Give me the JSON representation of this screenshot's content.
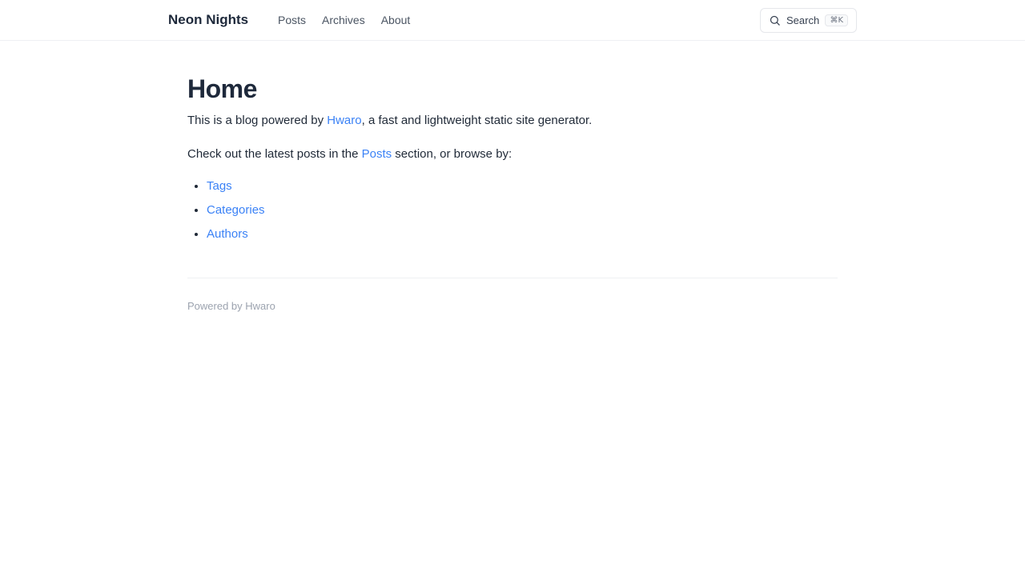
{
  "header": {
    "brand": "Neon Nights",
    "nav": [
      "Posts",
      "Archives",
      "About"
    ],
    "search": {
      "label": "Search",
      "shortcut": "⌘K",
      "icon": "search-icon"
    }
  },
  "main": {
    "title": "Home",
    "intro_prefix": "This is a blog powered by ",
    "intro_link": "Hwaro",
    "intro_suffix": ", a fast and lightweight static site generator.",
    "browse_prefix": "Check out the latest posts in the ",
    "browse_link": "Posts",
    "browse_suffix": " section, or browse by:",
    "list": [
      "Tags",
      "Categories",
      "Authors"
    ]
  },
  "footer": {
    "prefix": "Powered by ",
    "link": "Hwaro"
  },
  "colors": {
    "link": "#3b82f6",
    "text": "#1f2937",
    "muted": "#9ca3af",
    "border": "#eef0f3"
  }
}
